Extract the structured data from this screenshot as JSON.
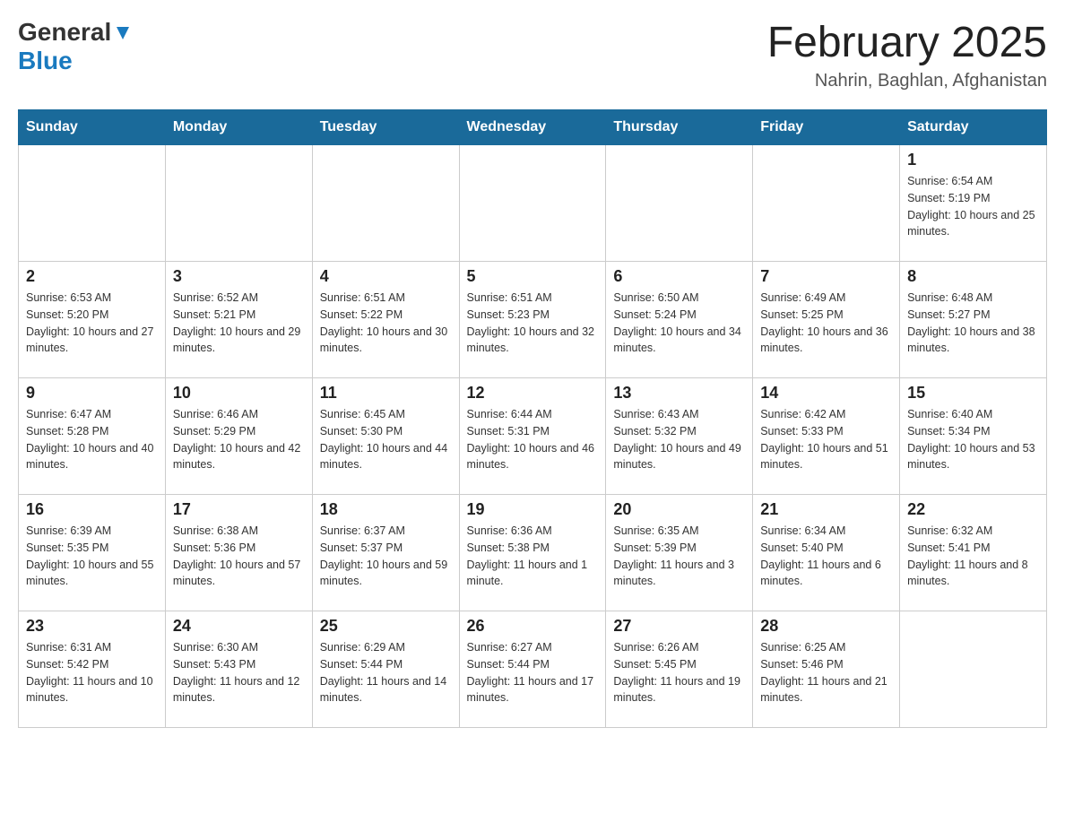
{
  "header": {
    "logo_general": "General",
    "logo_blue": "Blue",
    "month_title": "February 2025",
    "location": "Nahrin, Baghlan, Afghanistan"
  },
  "weekdays": [
    "Sunday",
    "Monday",
    "Tuesday",
    "Wednesday",
    "Thursday",
    "Friday",
    "Saturday"
  ],
  "weeks": [
    [
      {
        "day": "",
        "info": ""
      },
      {
        "day": "",
        "info": ""
      },
      {
        "day": "",
        "info": ""
      },
      {
        "day": "",
        "info": ""
      },
      {
        "day": "",
        "info": ""
      },
      {
        "day": "",
        "info": ""
      },
      {
        "day": "1",
        "info": "Sunrise: 6:54 AM\nSunset: 5:19 PM\nDaylight: 10 hours and 25 minutes."
      }
    ],
    [
      {
        "day": "2",
        "info": "Sunrise: 6:53 AM\nSunset: 5:20 PM\nDaylight: 10 hours and 27 minutes."
      },
      {
        "day": "3",
        "info": "Sunrise: 6:52 AM\nSunset: 5:21 PM\nDaylight: 10 hours and 29 minutes."
      },
      {
        "day": "4",
        "info": "Sunrise: 6:51 AM\nSunset: 5:22 PM\nDaylight: 10 hours and 30 minutes."
      },
      {
        "day": "5",
        "info": "Sunrise: 6:51 AM\nSunset: 5:23 PM\nDaylight: 10 hours and 32 minutes."
      },
      {
        "day": "6",
        "info": "Sunrise: 6:50 AM\nSunset: 5:24 PM\nDaylight: 10 hours and 34 minutes."
      },
      {
        "day": "7",
        "info": "Sunrise: 6:49 AM\nSunset: 5:25 PM\nDaylight: 10 hours and 36 minutes."
      },
      {
        "day": "8",
        "info": "Sunrise: 6:48 AM\nSunset: 5:27 PM\nDaylight: 10 hours and 38 minutes."
      }
    ],
    [
      {
        "day": "9",
        "info": "Sunrise: 6:47 AM\nSunset: 5:28 PM\nDaylight: 10 hours and 40 minutes."
      },
      {
        "day": "10",
        "info": "Sunrise: 6:46 AM\nSunset: 5:29 PM\nDaylight: 10 hours and 42 minutes."
      },
      {
        "day": "11",
        "info": "Sunrise: 6:45 AM\nSunset: 5:30 PM\nDaylight: 10 hours and 44 minutes."
      },
      {
        "day": "12",
        "info": "Sunrise: 6:44 AM\nSunset: 5:31 PM\nDaylight: 10 hours and 46 minutes."
      },
      {
        "day": "13",
        "info": "Sunrise: 6:43 AM\nSunset: 5:32 PM\nDaylight: 10 hours and 49 minutes."
      },
      {
        "day": "14",
        "info": "Sunrise: 6:42 AM\nSunset: 5:33 PM\nDaylight: 10 hours and 51 minutes."
      },
      {
        "day": "15",
        "info": "Sunrise: 6:40 AM\nSunset: 5:34 PM\nDaylight: 10 hours and 53 minutes."
      }
    ],
    [
      {
        "day": "16",
        "info": "Sunrise: 6:39 AM\nSunset: 5:35 PM\nDaylight: 10 hours and 55 minutes."
      },
      {
        "day": "17",
        "info": "Sunrise: 6:38 AM\nSunset: 5:36 PM\nDaylight: 10 hours and 57 minutes."
      },
      {
        "day": "18",
        "info": "Sunrise: 6:37 AM\nSunset: 5:37 PM\nDaylight: 10 hours and 59 minutes."
      },
      {
        "day": "19",
        "info": "Sunrise: 6:36 AM\nSunset: 5:38 PM\nDaylight: 11 hours and 1 minute."
      },
      {
        "day": "20",
        "info": "Sunrise: 6:35 AM\nSunset: 5:39 PM\nDaylight: 11 hours and 3 minutes."
      },
      {
        "day": "21",
        "info": "Sunrise: 6:34 AM\nSunset: 5:40 PM\nDaylight: 11 hours and 6 minutes."
      },
      {
        "day": "22",
        "info": "Sunrise: 6:32 AM\nSunset: 5:41 PM\nDaylight: 11 hours and 8 minutes."
      }
    ],
    [
      {
        "day": "23",
        "info": "Sunrise: 6:31 AM\nSunset: 5:42 PM\nDaylight: 11 hours and 10 minutes."
      },
      {
        "day": "24",
        "info": "Sunrise: 6:30 AM\nSunset: 5:43 PM\nDaylight: 11 hours and 12 minutes."
      },
      {
        "day": "25",
        "info": "Sunrise: 6:29 AM\nSunset: 5:44 PM\nDaylight: 11 hours and 14 minutes."
      },
      {
        "day": "26",
        "info": "Sunrise: 6:27 AM\nSunset: 5:44 PM\nDaylight: 11 hours and 17 minutes."
      },
      {
        "day": "27",
        "info": "Sunrise: 6:26 AM\nSunset: 5:45 PM\nDaylight: 11 hours and 19 minutes."
      },
      {
        "day": "28",
        "info": "Sunrise: 6:25 AM\nSunset: 5:46 PM\nDaylight: 11 hours and 21 minutes."
      },
      {
        "day": "",
        "info": ""
      }
    ]
  ]
}
